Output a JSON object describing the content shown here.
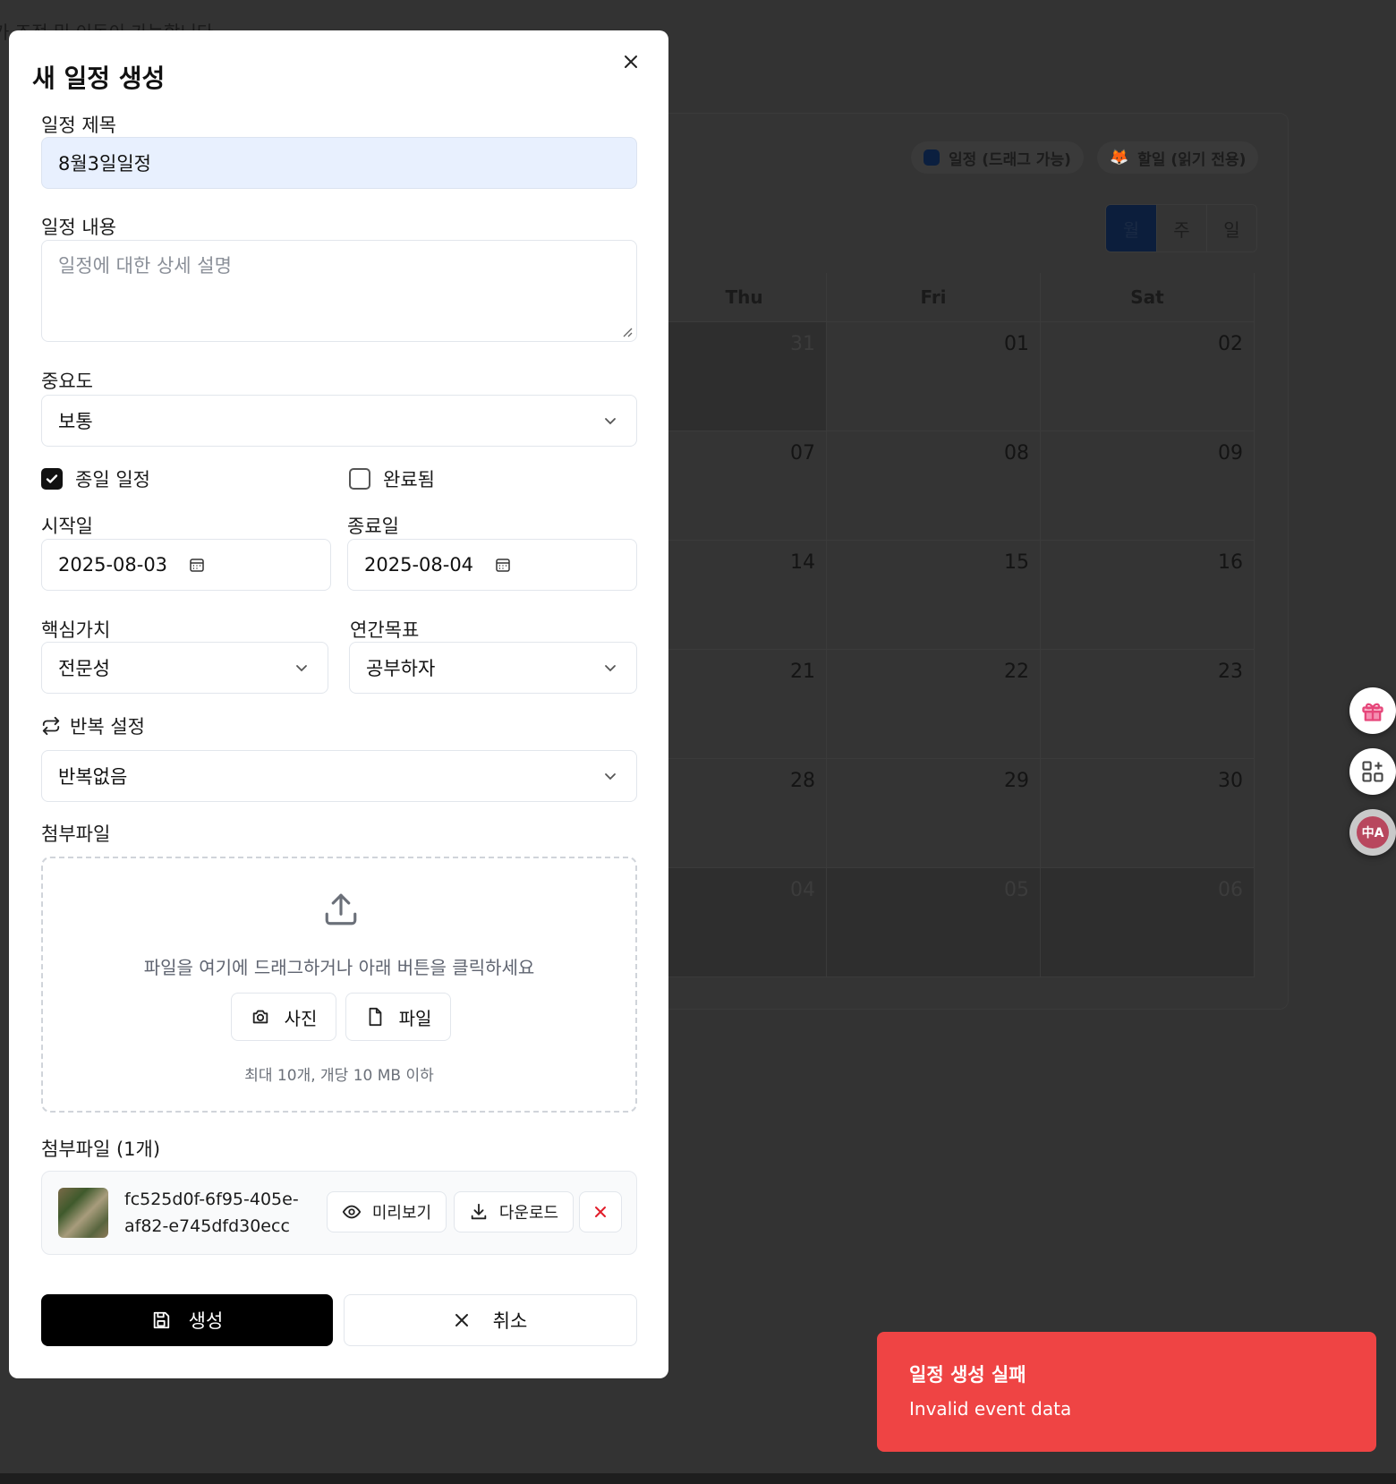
{
  "background": {
    "partial_text": "가 조정 및 이동이 가능합니다",
    "legend": [
      {
        "label": "일정 (드래그 가능)",
        "color": "#0b1f3f"
      },
      {
        "label": "할일 (읽기 전용)",
        "icon": "fox-icon"
      }
    ],
    "view_toggle": [
      "월",
      "주",
      "일"
    ],
    "calendar": {
      "headers": [
        "Thu",
        "Fri",
        "Sat"
      ],
      "rows": [
        [
          "31",
          "01",
          "02"
        ],
        [
          "07",
          "08",
          "09"
        ],
        [
          "14",
          "15",
          "16"
        ],
        [
          "21",
          "22",
          "23"
        ],
        [
          "28",
          "29",
          "30"
        ],
        [
          "04",
          "05",
          "06"
        ]
      ]
    },
    "side_buttons": [
      "gift-icon",
      "apps-add-icon",
      "translate-icon"
    ],
    "translate_label": "中A"
  },
  "modal": {
    "title": "새 일정 생성",
    "title_label": "일정 제목",
    "title_value": "8월3일일정",
    "content_label": "일정 내용",
    "content_placeholder": "일정에 대한 상세 설명",
    "priority_label": "중요도",
    "priority_value": "보통",
    "all_day_label": "종일 일정",
    "all_day_checked": true,
    "completed_label": "완료됨",
    "completed_checked": false,
    "start_label": "시작일",
    "start_value": "2025-08-03",
    "end_label": "종료일",
    "end_value": "2025-08-04",
    "core_value_label": "핵심가치",
    "core_value": "전문성",
    "annual_goal_label": "연간목표",
    "annual_goal": "공부하자",
    "repeat_label": "반복 설정",
    "repeat_value": "반복없음",
    "attach_label": "첨부파일",
    "dropzone_text": "파일을 여기에 드래그하거나 아래 버튼을 클릭하세요",
    "photo_button": "사진",
    "file_button": "파일",
    "dropzone_note": "최대 10개, 개당 10 MB 이하",
    "attach_list_label": "첨부파일 (1개)",
    "attachment": {
      "name_line1": "fc525d0f-6f95-405e-",
      "name_line2": "af82-e745dfd30ecc",
      "preview_label": "미리보기",
      "download_label": "다운로드"
    },
    "create_label": "생성",
    "cancel_label": "취소"
  },
  "toast": {
    "title": "일정 생성 실패",
    "description": "Invalid event data",
    "color": "#ef4444"
  }
}
